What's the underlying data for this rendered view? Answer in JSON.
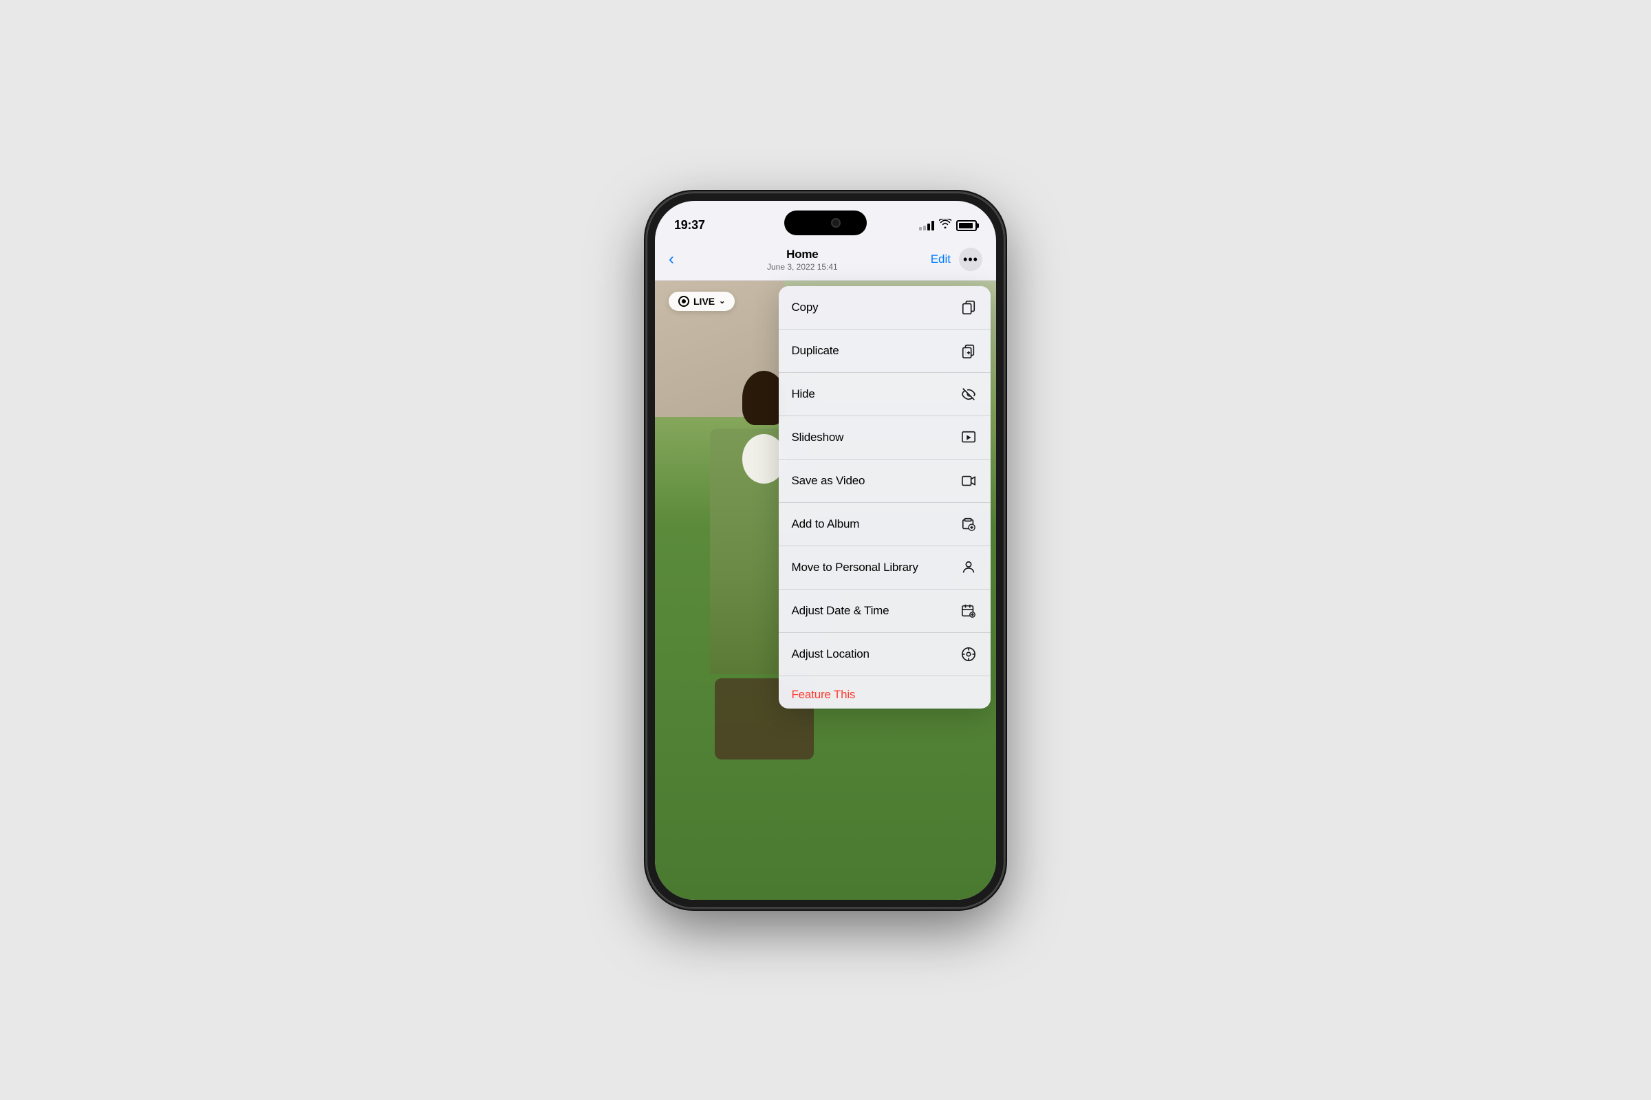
{
  "phone": {
    "statusBar": {
      "time": "19:37",
      "signal": "signal-icon",
      "wifi": "wifi-icon",
      "battery": "battery-icon"
    },
    "navBar": {
      "backLabel": "",
      "title": "Home",
      "subtitle": "June 3, 2022  15:41",
      "editLabel": "Edit",
      "moreLabel": "···"
    },
    "liveBadge": {
      "label": "LIVE",
      "chevron": "˅"
    },
    "contextMenu": {
      "items": [
        {
          "label": "Copy",
          "icon": "copy"
        },
        {
          "label": "Duplicate",
          "icon": "duplicate"
        },
        {
          "label": "Hide",
          "icon": "hide"
        },
        {
          "label": "Slideshow",
          "icon": "slideshow"
        },
        {
          "label": "Save as Video",
          "icon": "video"
        },
        {
          "label": "Add to Album",
          "icon": "add-album"
        },
        {
          "label": "Move to Personal Library",
          "icon": "person"
        },
        {
          "label": "Adjust Date & Time",
          "icon": "calendar"
        },
        {
          "label": "Adjust Location",
          "icon": "location"
        },
        {
          "label": "Feature This",
          "icon": "feature",
          "color": "red"
        }
      ]
    }
  }
}
